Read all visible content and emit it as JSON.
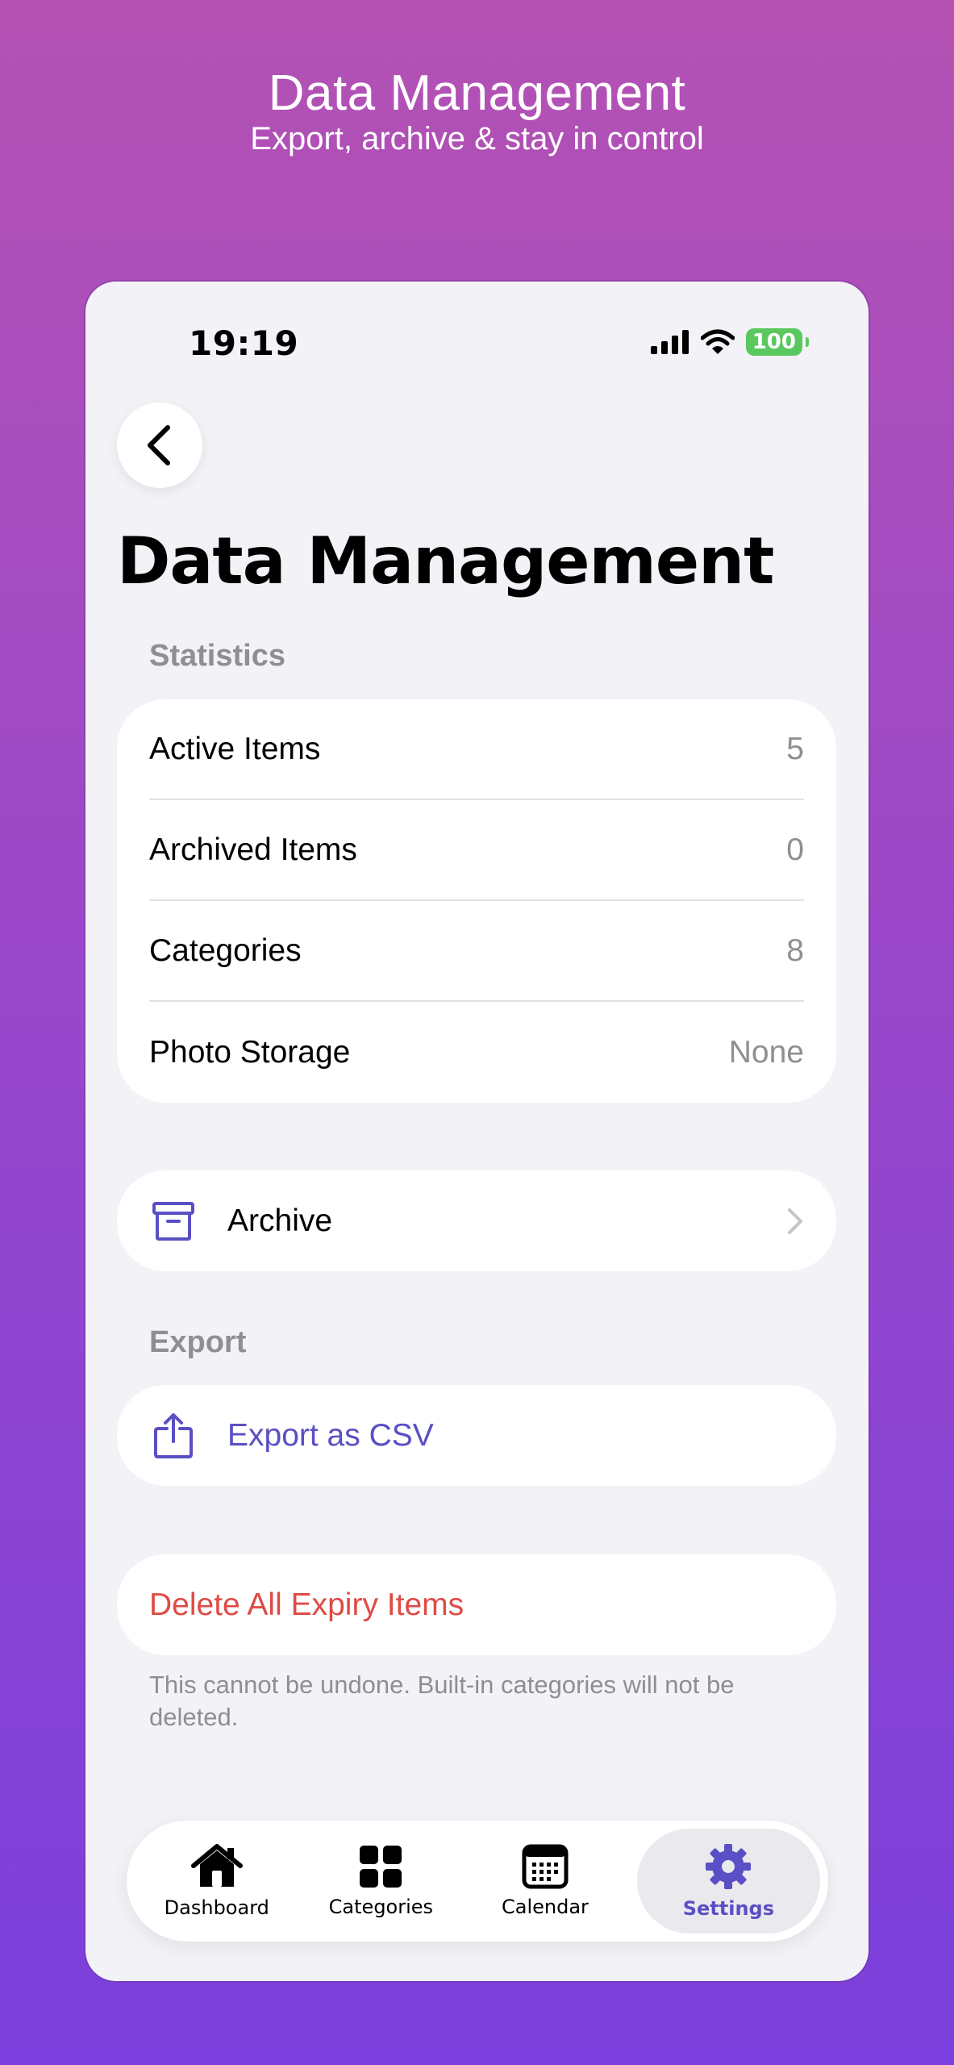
{
  "promo": {
    "title": "Data Management",
    "subtitle": "Export, archive & stay in control"
  },
  "status_bar": {
    "time": "19:19",
    "battery": "100"
  },
  "page": {
    "title": "Data Management"
  },
  "statistics": {
    "header": "Statistics",
    "rows": [
      {
        "label": "Active Items",
        "value": "5"
      },
      {
        "label": "Archived Items",
        "value": "0"
      },
      {
        "label": "Categories",
        "value": "8"
      },
      {
        "label": "Photo Storage",
        "value": "None"
      }
    ]
  },
  "archive": {
    "label": "Archive",
    "icon": "archive-box-icon"
  },
  "export": {
    "header": "Export",
    "csv_label": "Export as CSV",
    "icon": "share-icon"
  },
  "danger": {
    "delete_label": "Delete All Expiry Items",
    "footnote": "This cannot be undone. Built-in categories will not be deleted."
  },
  "tabbar": {
    "tabs": [
      {
        "label": "Dashboard",
        "icon": "house-icon"
      },
      {
        "label": "Categories",
        "icon": "grid-icon"
      },
      {
        "label": "Calendar",
        "icon": "calendar-icon"
      },
      {
        "label": "Settings",
        "icon": "gear-icon",
        "active": true
      }
    ]
  },
  "colors": {
    "accent": "#5a4fc4",
    "destructive": "#df4b46",
    "secondary_text": "#8e8e93",
    "battery": "#5ac85e"
  }
}
